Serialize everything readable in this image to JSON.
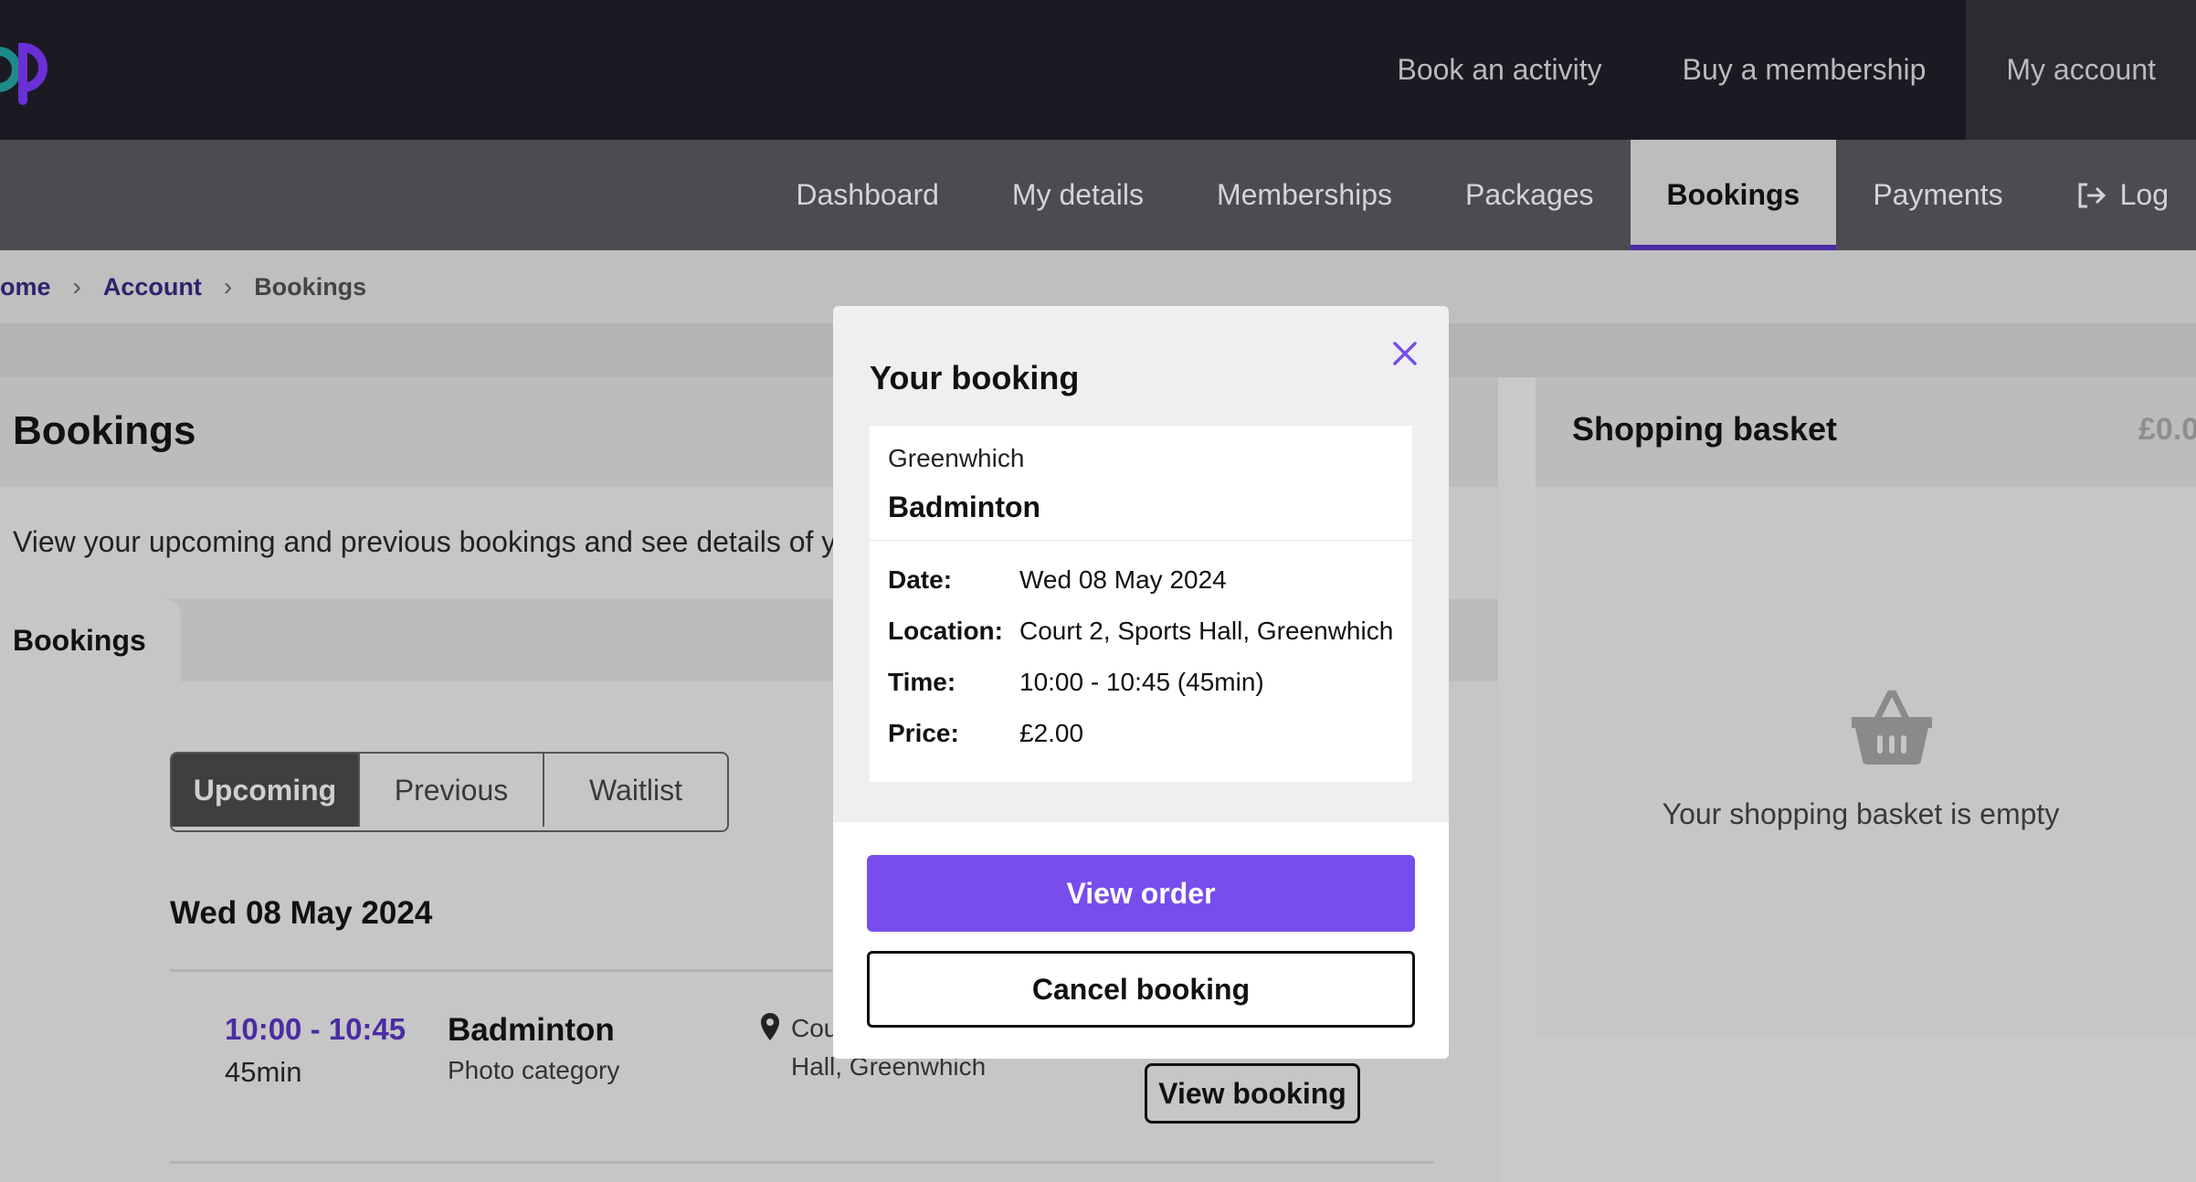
{
  "topnav": {
    "items": [
      {
        "label": "Book an activity"
      },
      {
        "label": "Buy a membership"
      },
      {
        "label": "My account",
        "active": true
      }
    ]
  },
  "subnav": {
    "items": [
      {
        "label": "Dashboard"
      },
      {
        "label": "My details"
      },
      {
        "label": "Memberships"
      },
      {
        "label": "Packages"
      },
      {
        "label": "Bookings",
        "active": true
      },
      {
        "label": "Payments"
      }
    ],
    "logout_label": "Log",
    "logout_icon": "logout-icon"
  },
  "breadcrumb": {
    "home": "ome",
    "account": "Account",
    "current": "Bookings"
  },
  "main": {
    "title": "Bookings",
    "description": "View your upcoming and previous bookings and see details of y",
    "tab_label": "Bookings",
    "segments": [
      "Upcoming",
      "Previous",
      "Waitlist"
    ],
    "active_segment": "Upcoming",
    "date_heading": "Wed 08 May 2024",
    "booking": {
      "time": "10:00 - 10:45",
      "duration": "45min",
      "activity": "Badminton",
      "category": "Photo category",
      "location": "Cou… Hall, Greenwhich",
      "location_line1": "Cou",
      "location_line2": "Hall, Greenwhich",
      "view_button": "View booking"
    }
  },
  "basket": {
    "title": "Shopping basket",
    "total": "£0.0",
    "empty_text": "Your shopping basket is empty",
    "icon": "basket-icon"
  },
  "modal": {
    "title": "Your booking",
    "venue": "Greenwhich",
    "activity": "Badminton",
    "details": [
      {
        "label": "Date:",
        "value": "Wed 08 May 2024"
      },
      {
        "label": "Location:",
        "value": "Court 2, Sports Hall, Greenwhich"
      },
      {
        "label": "Time:",
        "value": "10:00 - 10:45 (45min)"
      },
      {
        "label": "Price:",
        "value": "£2.00"
      }
    ],
    "primary_button": "View order",
    "secondary_button": "Cancel booking"
  },
  "colors": {
    "brand_purple": "#774dec",
    "accent_dark_purple": "#4b2ca3",
    "topbar": "#1b1a22"
  }
}
